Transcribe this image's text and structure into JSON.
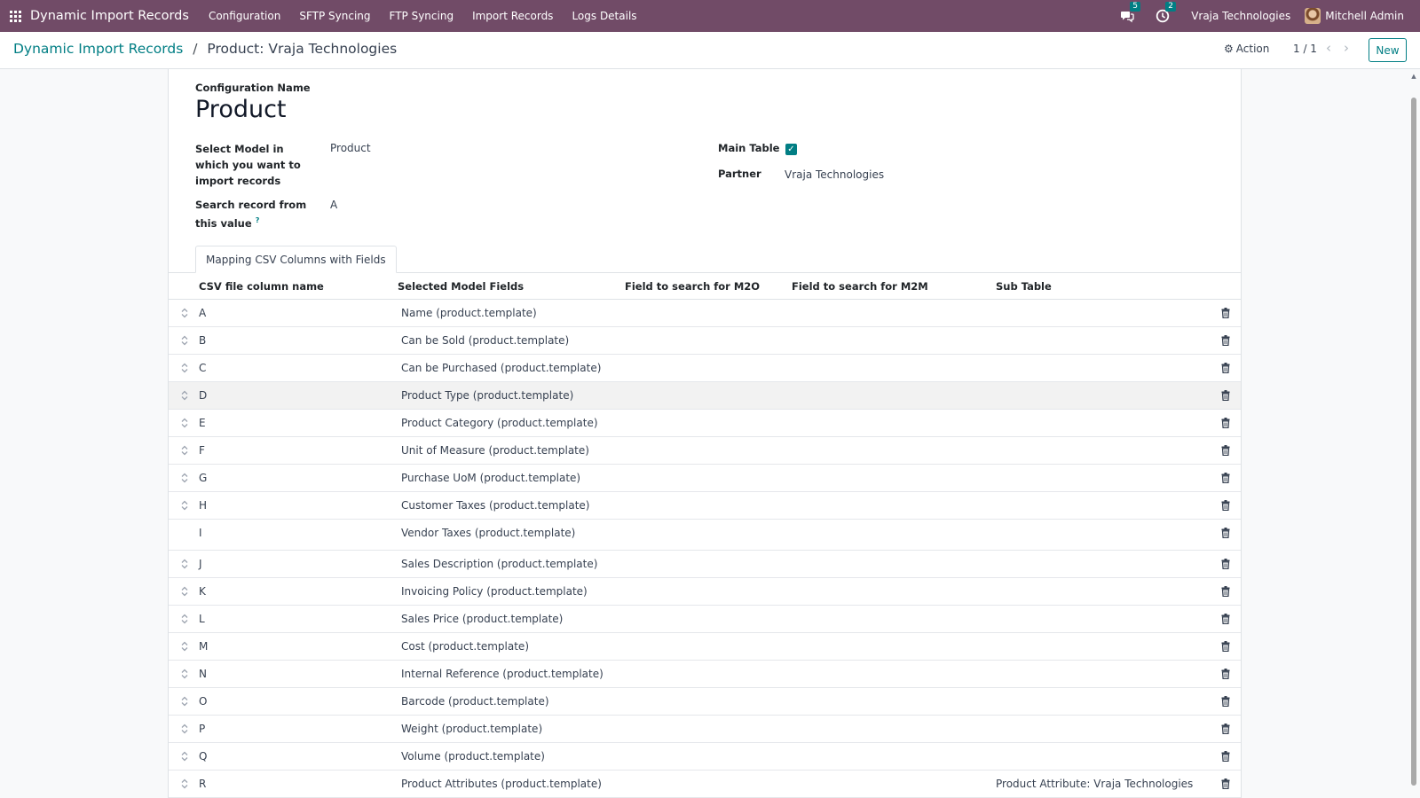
{
  "navbar": {
    "app_name": "Dynamic Import Records",
    "menu": [
      "Configuration",
      "SFTP Syncing",
      "FTP Syncing",
      "Import Records",
      "Logs Details"
    ],
    "messages_count": "5",
    "activities_count": "2",
    "company": "Vraja Technologies",
    "user": "Mitchell Admin",
    "bg_color": "#714B67"
  },
  "control_panel": {
    "breadcrumb_parent": "Dynamic Import Records",
    "breadcrumb_separator": "/",
    "breadcrumb_current": "Product: Vraja Technologies",
    "action_label": "Action",
    "pager": "1 / 1",
    "new_label": "New",
    "accent_color": "#017e84"
  },
  "form": {
    "config_name_label": "Configuration Name",
    "config_name": "Product",
    "model_label": "Select Model in which you want to import records",
    "model_value": "Product",
    "search_label": "Search record from this value",
    "search_tooltip": "?",
    "search_value": "A",
    "main_table_label": "Main Table",
    "main_table_checked": true,
    "partner_label": "Partner",
    "partner_value": "Vraja Technologies"
  },
  "tabs": [
    {
      "label": "Mapping CSV Columns with Fields",
      "active": true
    }
  ],
  "mapping_table": {
    "headers": {
      "csv_column": "CSV file column name",
      "model_fields": "Selected Model Fields",
      "m2o_field": "Field to search for M2O",
      "m2m_field": "Field to search for M2M",
      "sub_table": "Sub Table"
    },
    "rows": [
      {
        "csv": "A",
        "field": "Name (product.template)",
        "sub_table": ""
      },
      {
        "csv": "B",
        "field": "Can be Sold (product.template)",
        "sub_table": ""
      },
      {
        "csv": "C",
        "field": "Can be Purchased (product.template)",
        "sub_table": ""
      },
      {
        "csv": "D",
        "field": "Product Type (product.template)",
        "sub_table": ""
      },
      {
        "csv": "E",
        "field": "Product Category (product.template)",
        "sub_table": ""
      },
      {
        "csv": "F",
        "field": "Unit of Measure (product.template)",
        "sub_table": ""
      },
      {
        "csv": "G",
        "field": "Purchase UoM (product.template)",
        "sub_table": ""
      },
      {
        "csv": "H",
        "field": "Customer Taxes (product.template)",
        "sub_table": ""
      },
      {
        "csv": "I",
        "field": "Vendor Taxes (product.template)",
        "sub_table": ""
      },
      {
        "csv": "J",
        "field": "Sales Description (product.template)",
        "sub_table": ""
      },
      {
        "csv": "K",
        "field": "Invoicing Policy (product.template)",
        "sub_table": ""
      },
      {
        "csv": "L",
        "field": "Sales Price (product.template)",
        "sub_table": ""
      },
      {
        "csv": "M",
        "field": "Cost (product.template)",
        "sub_table": ""
      },
      {
        "csv": "N",
        "field": "Internal Reference (product.template)",
        "sub_table": ""
      },
      {
        "csv": "O",
        "field": "Barcode (product.template)",
        "sub_table": ""
      },
      {
        "csv": "P",
        "field": "Weight (product.template)",
        "sub_table": ""
      },
      {
        "csv": "Q",
        "field": "Volume (product.template)",
        "sub_table": ""
      },
      {
        "csv": "R",
        "field": "Product Attributes (product.template)",
        "sub_table": "Product Attribute: Vraja Technologies"
      }
    ]
  }
}
